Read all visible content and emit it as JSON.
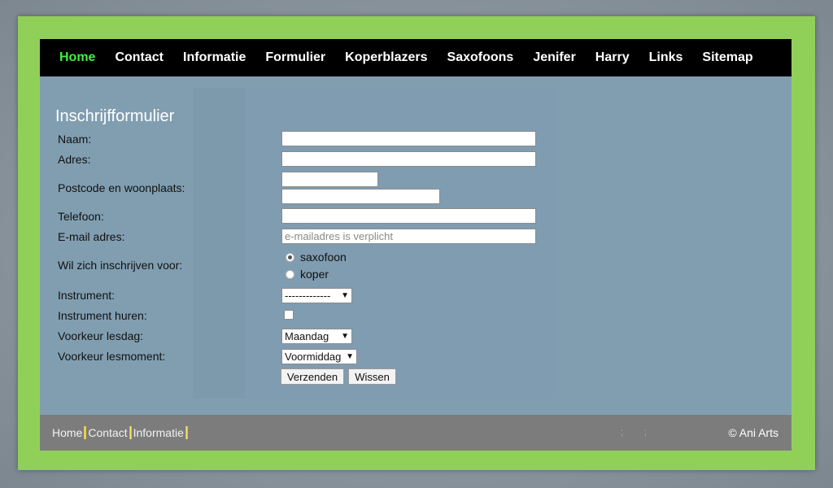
{
  "nav": {
    "items": [
      {
        "label": "Home",
        "active": true
      },
      {
        "label": "Contact"
      },
      {
        "label": "Informatie"
      },
      {
        "label": "Formulier"
      },
      {
        "label": "Koperblazers"
      },
      {
        "label": "Saxofoons"
      },
      {
        "label": "Jenifer"
      },
      {
        "label": "Harry"
      },
      {
        "label": "Links"
      },
      {
        "label": "Sitemap"
      }
    ]
  },
  "form": {
    "title": "Inschrijfformulier",
    "labels": {
      "naam": "Naam:",
      "adres": "Adres:",
      "postcode": "Postcode en woonplaats:",
      "telefoon": "Telefoon:",
      "email": "E-mail adres:",
      "inschrijven": "Wil zich inschrijven voor:",
      "instrument": "Instrument:",
      "huren": "Instrument huren:",
      "lesdag": "Voorkeur lesdag:",
      "lesmoment": "Voorkeur lesmoment:"
    },
    "email_placeholder": "e-mailadres is verplicht",
    "radio_options": [
      "saxofoon",
      "koper"
    ],
    "instrument_value": "-------------",
    "lesdag_value": "Maandag",
    "lesmoment_value": "Voormiddag",
    "submit_label": "Verzenden",
    "reset_label": "Wissen"
  },
  "footer": {
    "links": [
      "Home",
      "Contact",
      "Informatie"
    ],
    "dots": [
      ";",
      ";"
    ],
    "copyright": "© Ani Arts"
  },
  "colors": {
    "frame_green": "#91d058",
    "content_bg": "#819eb1",
    "nav_bg": "#000000",
    "nav_active": "#3cf23c",
    "footer_bg": "#7c7c7c"
  }
}
